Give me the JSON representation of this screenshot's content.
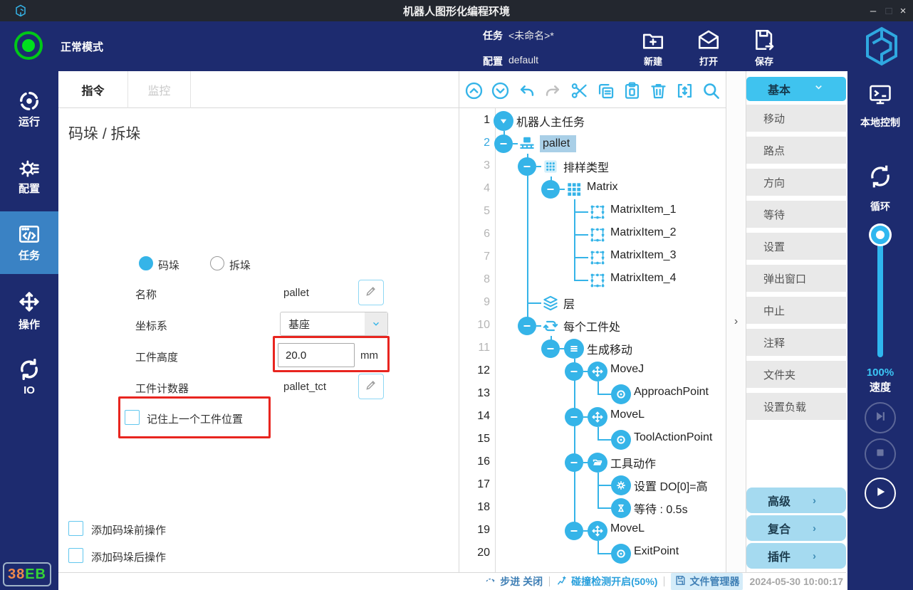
{
  "colors": {
    "accent_cyan": "#35b4e8",
    "navy": "#1d2b6f",
    "titlebar": "#23272f",
    "active_sidebar": "#3a82c4",
    "tree_selected_bg": "#a9cfe7",
    "annotation_red": "#e8251f",
    "cmd_header": "#3fc3ef",
    "cmd_group": "#a5daf0",
    "status_green": "#00d01e"
  },
  "title_bar": {
    "title": "机器人图形化编程环境",
    "minimize": "–",
    "maximize": "□",
    "close": "×"
  },
  "header": {
    "mode": "正常模式",
    "task_label": "任务",
    "task_value": "<未命名>*",
    "config_label": "配置",
    "config_value": "default",
    "buttons": [
      {
        "label": "新建",
        "icon": "new-task-icon"
      },
      {
        "label": "打开",
        "icon": "open-task-icon"
      },
      {
        "label": "保存",
        "icon": "save-task-icon"
      }
    ]
  },
  "left_sidebar": {
    "items": [
      {
        "label": "运行",
        "icon": "run-icon",
        "active": false
      },
      {
        "label": "配置",
        "icon": "config-gear-icon",
        "active": false
      },
      {
        "label": "任务",
        "icon": "task-code-icon",
        "active": true
      },
      {
        "label": "操作",
        "icon": "jog-arrows-icon",
        "active": false
      },
      {
        "label": "IO",
        "icon": "io-swap-icon",
        "active": false
      }
    ],
    "badge": {
      "text_orange": "38",
      "text_green": "EB"
    }
  },
  "main": {
    "tabs": [
      {
        "label": "指令",
        "active": true
      },
      {
        "label": "监控",
        "active": false
      }
    ],
    "form": {
      "title": "码垛 / 拆垛",
      "radios": [
        {
          "label": "码垛",
          "selected": true
        },
        {
          "label": "拆垛",
          "selected": false
        }
      ],
      "fields": [
        {
          "label": "名称",
          "value": "pallet"
        },
        {
          "label": "坐标系",
          "value": "基座"
        },
        {
          "label": "工件高度",
          "value": "20.0",
          "unit": "mm"
        },
        {
          "label": "工件计数器",
          "value": "pallet_tct"
        }
      ],
      "remember_checkbox": {
        "label": "记住上一个工件位置",
        "checked": false
      },
      "bottom_checkboxes": [
        {
          "label": "添加码垛前操作",
          "checked": false
        },
        {
          "label": "添加码垛后操作",
          "checked": false
        }
      ]
    }
  },
  "tree": {
    "toolbar_icons": [
      "collapse-all-icon",
      "expand-all-icon",
      "undo-icon",
      "redo-icon",
      "cut-icon",
      "copy-icon",
      "paste-icon",
      "delete-icon",
      "insert-icon",
      "search-icon"
    ],
    "toolbar_disabled": [
      3
    ],
    "nodes": [
      {
        "num": "1",
        "depth": 0,
        "icon": "robot-task-toggle-icon",
        "label": "机器人主任务",
        "collapse": false,
        "selected": false,
        "num_color": "dark"
      },
      {
        "num": "2",
        "depth": 1,
        "icon": "pallet-icon",
        "label": "pallet",
        "collapse": true,
        "selected": true,
        "num_color": "blue"
      },
      {
        "num": "3",
        "depth": 2,
        "icon": "pattern-type-icon",
        "label": "排样类型",
        "collapse": true,
        "selected": false,
        "num_color": "gray"
      },
      {
        "num": "4",
        "depth": 3,
        "icon": "matrix-icon",
        "label": "Matrix",
        "collapse": true,
        "selected": false,
        "num_color": "gray"
      },
      {
        "num": "5",
        "depth": 4,
        "icon": "matrix-item-icon",
        "label": "MatrixItem_1",
        "collapse": false,
        "selected": false,
        "num_color": "gray"
      },
      {
        "num": "6",
        "depth": 4,
        "icon": "matrix-item-icon",
        "label": "MatrixItem_2",
        "collapse": false,
        "selected": false,
        "num_color": "gray"
      },
      {
        "num": "7",
        "depth": 4,
        "icon": "matrix-item-icon",
        "label": "MatrixItem_3",
        "collapse": false,
        "selected": false,
        "num_color": "gray"
      },
      {
        "num": "8",
        "depth": 4,
        "icon": "matrix-item-icon",
        "label": "MatrixItem_4",
        "collapse": false,
        "selected": false,
        "num_color": "gray"
      },
      {
        "num": "9",
        "depth": 2,
        "icon": "layers-icon",
        "label": "层",
        "collapse": false,
        "selected": false,
        "num_color": "gray"
      },
      {
        "num": "10",
        "depth": 2,
        "icon": "per-workpiece-loop-icon",
        "label": "每个工件处",
        "collapse": true,
        "selected": false,
        "num_color": "gray"
      },
      {
        "num": "11",
        "depth": 3,
        "icon": "generate-move-icon",
        "label": "生成移动",
        "collapse": true,
        "selected": false,
        "num_color": "gray"
      },
      {
        "num": "12",
        "depth": 4,
        "icon": "move-icon",
        "label": "MoveJ",
        "collapse": true,
        "selected": false,
        "num_color": "dark"
      },
      {
        "num": "13",
        "depth": 5,
        "icon": "point-icon",
        "label": "ApproachPoint",
        "collapse": false,
        "selected": false,
        "num_color": "dark"
      },
      {
        "num": "14",
        "depth": 4,
        "icon": "move-icon",
        "label": "MoveL",
        "collapse": true,
        "selected": false,
        "num_color": "dark"
      },
      {
        "num": "15",
        "depth": 5,
        "icon": "point-icon",
        "label": "ToolActionPoint",
        "collapse": false,
        "selected": false,
        "num_color": "dark"
      },
      {
        "num": "16",
        "depth": 4,
        "icon": "tool-action-folder-icon",
        "label": "工具动作",
        "collapse": true,
        "selected": false,
        "num_color": "dark"
      },
      {
        "num": "17",
        "depth": 5,
        "icon": "set-do-gear-icon",
        "label": "设置 DO[0]=高",
        "collapse": false,
        "selected": false,
        "num_color": "dark"
      },
      {
        "num": "18",
        "depth": 5,
        "icon": "wait-hourglass-icon",
        "label": "等待 : 0.5s",
        "collapse": false,
        "selected": false,
        "num_color": "dark"
      },
      {
        "num": "19",
        "depth": 4,
        "icon": "move-icon",
        "label": "MoveL",
        "collapse": true,
        "selected": false,
        "num_color": "dark"
      },
      {
        "num": "20",
        "depth": 5,
        "icon": "point-icon",
        "label": "ExitPoint",
        "collapse": false,
        "selected": false,
        "num_color": "dark"
      }
    ]
  },
  "panel_handle": {
    "chevron": "›"
  },
  "command_panel": {
    "header": {
      "label": "基本"
    },
    "items": [
      "移动",
      "路点",
      "方向",
      "等待",
      "设置",
      "弹出窗口",
      "中止",
      "注释",
      "文件夹",
      "设置负载"
    ],
    "groups": [
      {
        "label": "高级",
        "chevron": "›"
      },
      {
        "label": "复合",
        "chevron": "›"
      },
      {
        "label": "插件",
        "chevron": "›"
      }
    ]
  },
  "right_sidebar": {
    "local_control_label": "本地控制",
    "loop_label": "循环",
    "speed_percent": "100%",
    "speed_label": "速度"
  },
  "status_bar": {
    "step_text": "步进 关闭",
    "collision_text": "碰撞检测开启(50%)",
    "file_manager_text": "文件管理器",
    "timestamp": "2024-05-30 10:00:17"
  }
}
